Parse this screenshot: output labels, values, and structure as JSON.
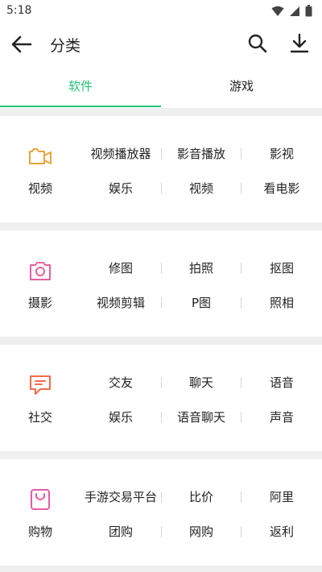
{
  "status": {
    "time": "5:18"
  },
  "header": {
    "title": "分类"
  },
  "tabs": [
    {
      "label": "软件",
      "active": true
    },
    {
      "label": "游戏",
      "active": false
    }
  ],
  "colors": {
    "accent": "#23c277"
  },
  "categories": [
    {
      "name": "视频",
      "icon": "video-camera-icon",
      "icon_color": "#e8a53a",
      "tags": [
        "视频播放器",
        "影音播放",
        "影视",
        "娱乐",
        "视频",
        "看电影"
      ]
    },
    {
      "name": "摄影",
      "icon": "camera-icon",
      "icon_color": "#e9609b",
      "tags": [
        "修图",
        "拍照",
        "抠图",
        "视频剪辑",
        "P图",
        "照相"
      ]
    },
    {
      "name": "社交",
      "icon": "chat-bubble-icon",
      "icon_color": "#f26b4a",
      "tags": [
        "交友",
        "聊天",
        "语音",
        "娱乐",
        "语音聊天",
        "声音"
      ]
    },
    {
      "name": "购物",
      "icon": "shopping-bag-icon",
      "icon_color": "#ea5aa8",
      "tags": [
        "手游交易平台",
        "比价",
        "阿里",
        "团购",
        "网购",
        "返利"
      ]
    }
  ]
}
